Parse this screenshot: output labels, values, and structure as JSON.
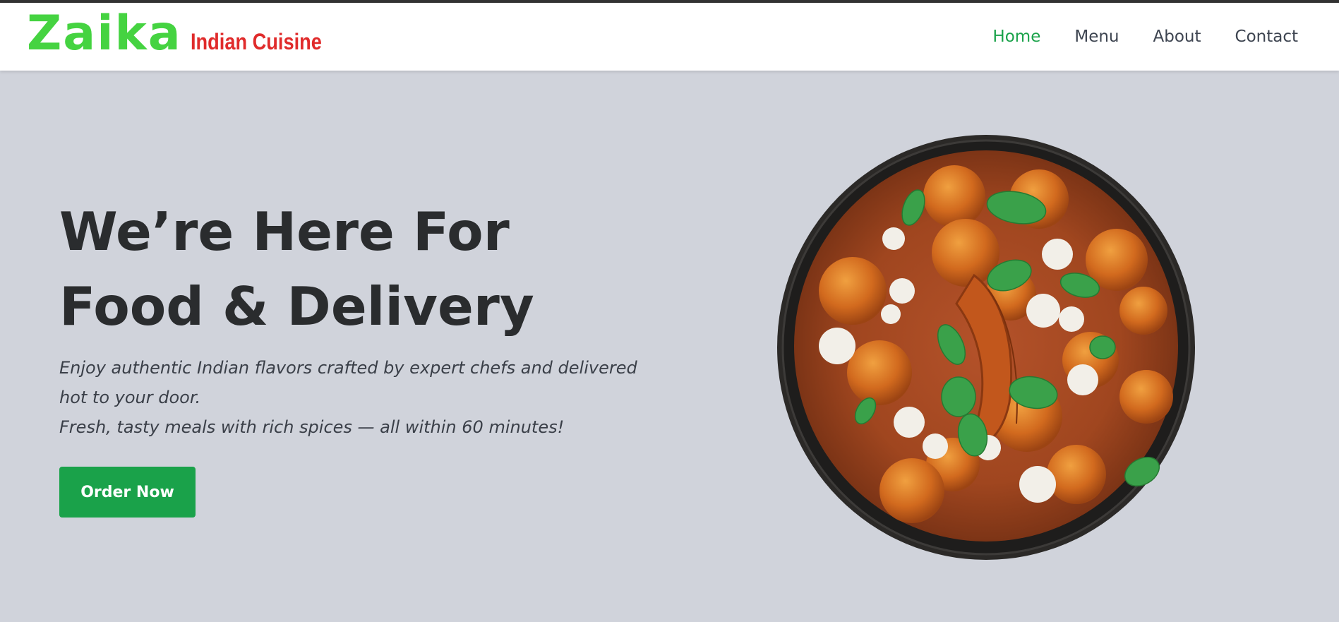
{
  "brand": {
    "name": "Zaika",
    "tagline": "Indian Cuisine"
  },
  "nav": {
    "items": [
      "Home",
      "Menu",
      "About",
      "Contact"
    ],
    "active": "Home"
  },
  "hero": {
    "title_line1": "We’re Here For",
    "title_line2": "Food & Delivery",
    "desc_line1": "Enjoy authentic Indian flavors crafted by expert chefs and delivered hot to your door.",
    "desc_line2": "Fresh, tasty meals with rich spices — all within 60 minutes!",
    "cta_label": "Order Now"
  },
  "colors": {
    "brand_green": "#45d341",
    "brand_red": "#e02b2b",
    "accent": "#1aa24a",
    "background": "#d0d3db",
    "heading": "#2a2c2e"
  },
  "image": {
    "semantic": "curry-bowl-image"
  }
}
